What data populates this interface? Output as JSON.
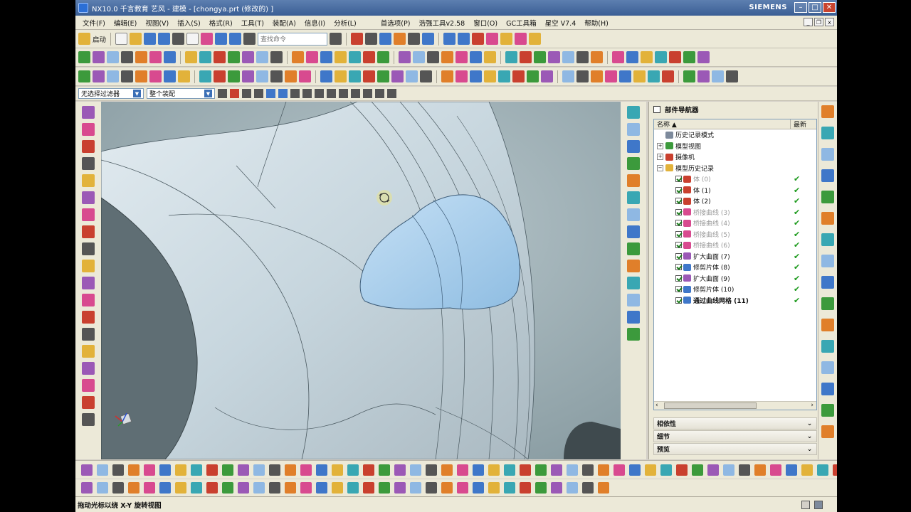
{
  "window": {
    "title": "NX10.0 千言教育 艺风 - 建模 - [chongya.prt  (修改的) ]",
    "brand": "SIEMENS",
    "min": "–",
    "max": "□",
    "close": "✕"
  },
  "menu": [
    "文件(F)",
    "编辑(E)",
    "视图(V)",
    "插入(S)",
    "格式(R)",
    "工具(T)",
    "装配(A)",
    "信息(I)",
    "分析(L)",
    "首选项(P)",
    "浩强工具v2.58",
    "窗口(O)",
    "GC工具箱",
    "星空 V7.4",
    "帮助(H)"
  ],
  "standard_toolbar": {
    "start_label": "启动",
    "search_placeholder": "查找命令"
  },
  "filterbar": {
    "selection_filter": "无选择过滤器",
    "assembly_scope": "整个装配"
  },
  "navigator": {
    "title": "部件导航器",
    "col_name": "名称",
    "col_latest": "最新",
    "nodes": [
      {
        "label": "历史记录模式",
        "indent": 0,
        "expander": "",
        "checkbox": false,
        "dim": false,
        "bold": false,
        "check": false,
        "icon": "history-icon",
        "color": "#7d8a9c"
      },
      {
        "label": "模型视图",
        "indent": 0,
        "expander": "+",
        "checkbox": false,
        "dim": false,
        "bold": false,
        "check": false,
        "icon": "model-views-icon",
        "color": "#3c9a3c"
      },
      {
        "label": "摄像机",
        "indent": 0,
        "expander": "+",
        "checkbox": false,
        "dim": false,
        "bold": false,
        "check": false,
        "icon": "camera-icon",
        "color": "#c9402f"
      },
      {
        "label": "模型历史记录",
        "indent": 0,
        "expander": "−",
        "checkbox": false,
        "dim": false,
        "bold": false,
        "check": false,
        "icon": "folder-icon",
        "color": "#e2b23a"
      },
      {
        "label": "体 (0)",
        "indent": 1,
        "expander": "",
        "checkbox": true,
        "dim": true,
        "bold": false,
        "check": true,
        "icon": "body-icon",
        "color": "#c9402f"
      },
      {
        "label": "体 (1)",
        "indent": 1,
        "expander": "",
        "checkbox": true,
        "dim": false,
        "bold": false,
        "check": true,
        "icon": "body-icon",
        "color": "#c9402f"
      },
      {
        "label": "体 (2)",
        "indent": 1,
        "expander": "",
        "checkbox": true,
        "dim": false,
        "bold": false,
        "check": true,
        "icon": "body-icon",
        "color": "#c9402f"
      },
      {
        "label": "桥接曲线 (3)",
        "indent": 1,
        "expander": "",
        "checkbox": true,
        "dim": true,
        "bold": false,
        "check": true,
        "icon": "bridge-curve-icon",
        "color": "#d84a8f"
      },
      {
        "label": "桥接曲线 (4)",
        "indent": 1,
        "expander": "",
        "checkbox": true,
        "dim": true,
        "bold": false,
        "check": true,
        "icon": "bridge-curve-icon",
        "color": "#d84a8f"
      },
      {
        "label": "桥接曲线 (5)",
        "indent": 1,
        "expander": "",
        "checkbox": true,
        "dim": true,
        "bold": false,
        "check": true,
        "icon": "bridge-curve-icon",
        "color": "#d84a8f"
      },
      {
        "label": "桥接曲线 (6)",
        "indent": 1,
        "expander": "",
        "checkbox": true,
        "dim": true,
        "bold": false,
        "check": true,
        "icon": "bridge-curve-icon",
        "color": "#d84a8f"
      },
      {
        "label": "扩大曲面 (7)",
        "indent": 1,
        "expander": "",
        "checkbox": true,
        "dim": false,
        "bold": false,
        "check": true,
        "icon": "enlarge-surface-icon",
        "color": "#9b59b6"
      },
      {
        "label": "修剪片体 (8)",
        "indent": 1,
        "expander": "",
        "checkbox": true,
        "dim": false,
        "bold": false,
        "check": true,
        "icon": "trim-sheet-icon",
        "color": "#3f77c9"
      },
      {
        "label": "扩大曲面 (9)",
        "indent": 1,
        "expander": "",
        "checkbox": true,
        "dim": false,
        "bold": false,
        "check": true,
        "icon": "enlarge-surface-icon",
        "color": "#9b59b6"
      },
      {
        "label": "修剪片体 (10)",
        "indent": 1,
        "expander": "",
        "checkbox": true,
        "dim": false,
        "bold": false,
        "check": true,
        "icon": "trim-sheet-icon",
        "color": "#3f77c9"
      },
      {
        "label": "通过曲线网格 (11)",
        "indent": 1,
        "expander": "",
        "checkbox": true,
        "dim": false,
        "bold": true,
        "check": true,
        "icon": "through-curve-mesh-icon",
        "color": "#3f77c9"
      }
    ],
    "panels": [
      "相依性",
      "细节",
      "预览"
    ]
  },
  "status": {
    "text": "拖动光标以绕 X-Y 旋转视图"
  },
  "colors": {
    "title_bar": "#3a5e94",
    "chrome": "#ece9d8",
    "model_surface": "#c9d6dd",
    "highlight_face": "#a9cfee",
    "check_green": "#1c9a1c"
  }
}
